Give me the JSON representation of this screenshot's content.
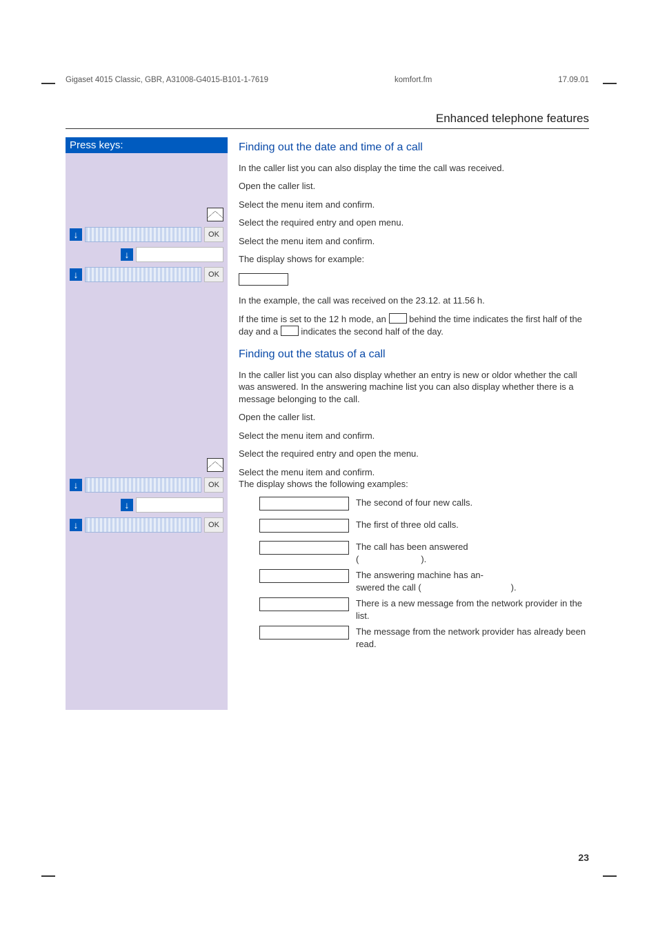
{
  "header": {
    "left": "Gigaset 4015 Classic, GBR, A31008-G4015-B101-1-7619",
    "mid": "komfort.fm",
    "right": "17.09.01"
  },
  "section_title": "Enhanced telephone features",
  "presskeys": "Press keys:",
  "ok": "OK",
  "sec1": {
    "title": "Finding out the date and time of a call",
    "intro": "In the caller list you can also display the time the call was received.",
    "l1": "Open the caller list.",
    "l2": "Select the menu item and confirm.",
    "l3": "Select the required entry and open menu.",
    "l4": "Select the menu item and confirm.",
    "l5": "The display shows for example:",
    "p1a": "In the example, the call was received on the 23.12. at 11.56 h.",
    "p1b1": "If the time is set to the 12 h mode, an",
    "p1b2": "behind the time indicates the first half of the day and a",
    "p1b3": "indicates the second half of the day."
  },
  "sec2": {
    "title": "Finding out the status of a call",
    "intro": "In the caller list you can also display whether an entry is new or oldor whether the call was answered. In the answering machine list you can also display whether there is a message belonging to the call.",
    "l1": "Open the caller list.",
    "l2": "Select the menu item and confirm.",
    "l3": "Select the required entry and open the menu.",
    "l4a": "Select the menu item and confirm.",
    "l4b": "The display shows the following examples:",
    "r1": "The second of four new calls.",
    "r2": "The first of three old calls.",
    "r3a": "The call has been answered",
    "r3b": "(",
    "r3c": ").",
    "r4a": "The answering machine has an-",
    "r4b": "swered the call (",
    "r4c": ").",
    "r5": "There is a new message from the network provider in the list.",
    "r6": "The message from the network provider has already been read."
  },
  "pagenum": "23"
}
